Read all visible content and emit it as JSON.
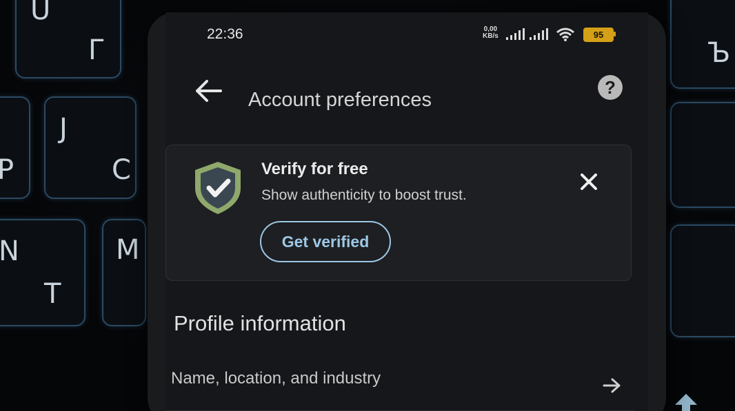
{
  "status_bar": {
    "time": "22:36",
    "net_speed_value": "0,00",
    "net_speed_unit": "KB/s",
    "battery_level": "95"
  },
  "header": {
    "title": "Account preferences",
    "help_label": "?"
  },
  "verify_card": {
    "title": "Verify for free",
    "description": "Show authenticity to boost trust.",
    "button_label": "Get verified"
  },
  "profile_section": {
    "title": "Profile information",
    "items": [
      {
        "label": "Name, location, and industry"
      }
    ]
  },
  "keyboard_keys": [
    "U",
    "Г",
    "J",
    "С",
    "N",
    "Т",
    "Ъ",
    "М",
    "Р"
  ],
  "colors": {
    "accent": "#9ec8e6",
    "battery": "#d4a017",
    "shield_outer": "#8fa86b",
    "shield_inner": "#3a4650"
  }
}
